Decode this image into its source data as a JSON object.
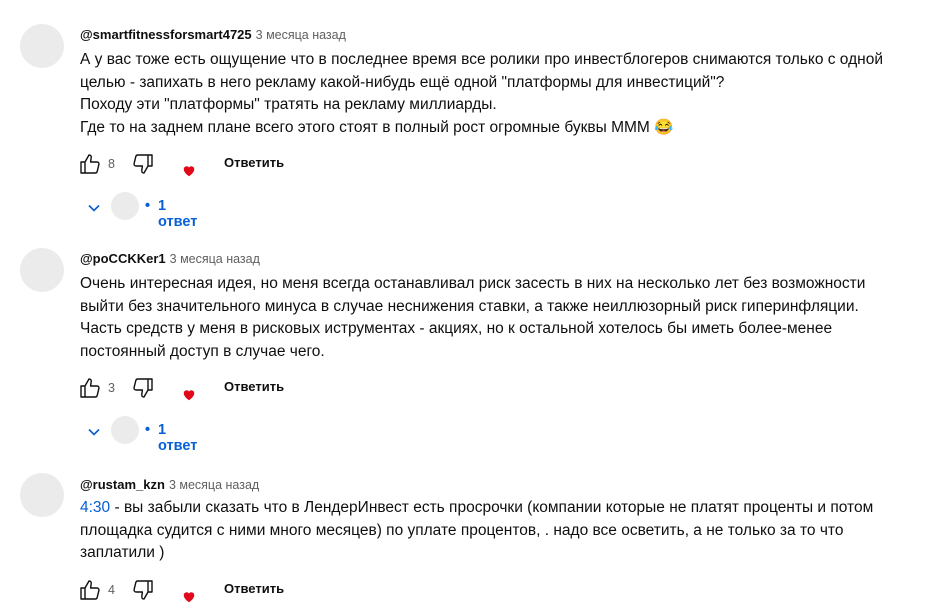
{
  "comments": [
    {
      "author": "@smartfitnessforsmart4725",
      "time": "3 месяца назад",
      "lines": [
        "А у вас тоже есть ощущение что в последнее время все ролики про инвестблогеров снимаются только с одной",
        "целью - запихать в него рекламу какой-нибудь ещё одной \"платформы для инвестиций\"?",
        "Походу эти \"платформы\" тратять на рекламу миллиарды.",
        "Где то на заднем плане всего этого стоят в полный рост огромные буквы МММ"
      ],
      "emoji": "😂",
      "likes": "8",
      "reply_label": "Ответить",
      "replies_dot": "•",
      "replies_label": "1 ответ"
    },
    {
      "author": "@poCCKKer1",
      "time": "3 месяца назад",
      "lines": [
        "Очень интересная идея, но меня всегда останавливал риск засесть в них на несколько лет без возможности",
        "выйти без значительного минуса в случае неснижения ставки, а также неиллюзорный риск гиперинфляции.",
        "Часть средств у меня в рисковых иструментах - акциях, но к остальной хотелось бы иметь более-менее",
        "постоянный доступ в случае чего."
      ],
      "likes": "3",
      "reply_label": "Ответить",
      "replies_dot": "•",
      "replies_label": "1 ответ"
    },
    {
      "author": "@rustam_kzn",
      "time": "3 месяца назад",
      "timestamp_link": "4:30",
      "lines": [
        " - вы забыли сказать что в ЛендерИнвест есть просрочки (компании которые не платят проценты и потом",
        "площадка судится с ними много месяцев) по уплате процентов, . надо все осветить, а не только за то что",
        "заплатили )"
      ],
      "likes": "4",
      "reply_label": "Ответить"
    }
  ],
  "icons": {
    "like": "thumb-up-icon",
    "dislike": "thumb-down-icon",
    "heart": "creator-heart-icon",
    "chevron": "chevron-down-icon"
  },
  "colors": {
    "link": "#065fd4",
    "heart": "#e0081a",
    "avatar": "#ebebeb",
    "meta": "#606060"
  }
}
